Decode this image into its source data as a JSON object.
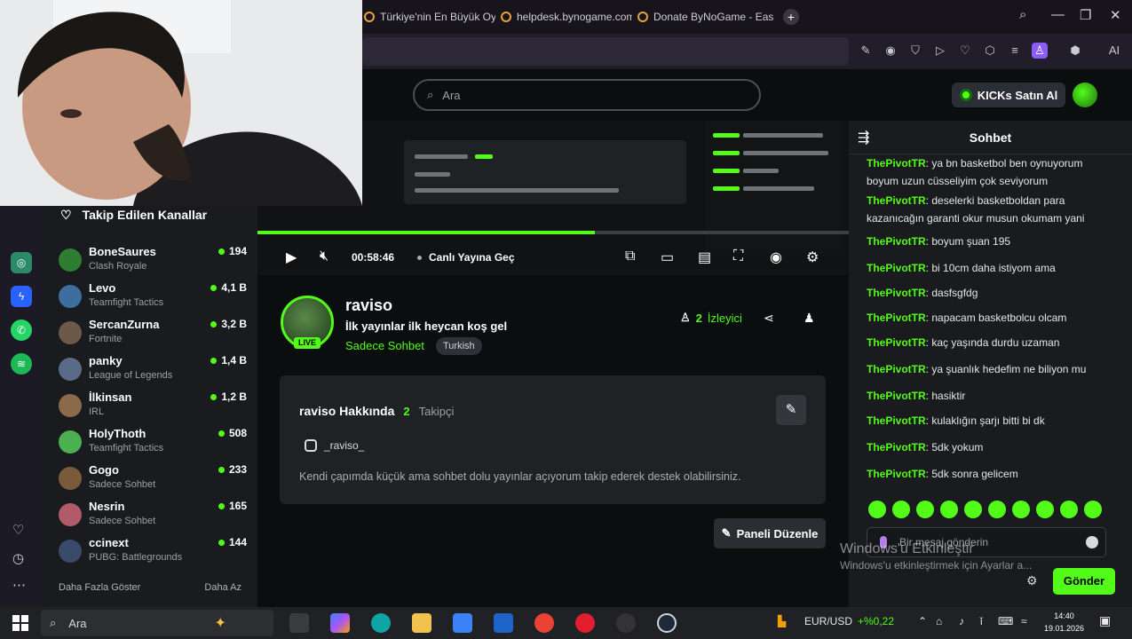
{
  "browser": {
    "tabs": [
      {
        "label": "Türkiye'nin En Büyük Oyu",
        "close": "×"
      },
      {
        "label": "helpdesk.bynogame.com/",
        "close": "×"
      },
      {
        "label": "Donate ByNoGame - Eas",
        "close": "×"
      }
    ],
    "new_tab": "+",
    "ai_label": "AI",
    "accent": "#8b5cf6"
  },
  "header": {
    "search_placeholder": "Ara",
    "buy_kicks": "KICKs Satın Al"
  },
  "sidebar": {
    "title": "Takip Edilen Kanallar",
    "channels": [
      {
        "name": "BoneSaures",
        "category": "Clash Royale",
        "viewers": "194",
        "color": "#2e7d32"
      },
      {
        "name": "Levo",
        "category": "Teamfight Tactics",
        "viewers": "4,1 B",
        "color": "#3c6e9e"
      },
      {
        "name": "SercanZurna",
        "category": "Fortnite",
        "viewers": "3,2 B",
        "color": "#6b5a4a"
      },
      {
        "name": "panky",
        "category": "League of Legends",
        "viewers": "1,4 B",
        "color": "#5a6b8a"
      },
      {
        "name": "İlkinsan",
        "category": "IRL",
        "viewers": "1,2 B",
        "color": "#8a6a4a"
      },
      {
        "name": "HolyThoth",
        "category": "Teamfight Tactics",
        "viewers": "508",
        "color": "#4caf50"
      },
      {
        "name": "Gogo",
        "category": "Sadece Sohbet",
        "viewers": "233",
        "color": "#7a5a3a"
      },
      {
        "name": "Nesrin",
        "category": "Sadece Sohbet",
        "viewers": "165",
        "color": "#b05a6a"
      },
      {
        "name": "ccinext",
        "category": "PUBG: Battlegrounds",
        "viewers": "144",
        "color": "#3a4a6a"
      }
    ],
    "show_more": "Daha Fazla Göster",
    "show_less": "Daha Az"
  },
  "player": {
    "time": "00:58:46",
    "go_live": "Canlı Yayına Geç",
    "progress": 0.57
  },
  "channel": {
    "name": "raviso",
    "stream_title": "İlk yayınlar ilk heycan koş gel",
    "category": "Sadece Sohbet",
    "tag": "Turkish",
    "live_badge": "LIVE",
    "viewer_count": "2",
    "viewer_label": "İzleyici"
  },
  "about": {
    "title": "raviso Hakkında",
    "follower_count": "2",
    "follower_label": "Takipçi",
    "instagram": "_raviso_",
    "description": "Kendi çapımda küçük ama sohbet dolu yayınlar açıyorum takip ederek destek olabilirsiniz.",
    "edit_panel": "Paneli Düzenle"
  },
  "chat": {
    "title": "Sohbet",
    "messages": [
      {
        "user": "ThePivotTR",
        "text": "ya bn basketbol ben oynuyorum boyum uzun cüsseliyim çok seviyorum"
      },
      {
        "user": "ThePivotTR",
        "text": "deselerki basketboldan para kazanıcağın garanti okur musun okumam yani"
      },
      {
        "user": "ThePivotTR",
        "text": "boyum şuan 195"
      },
      {
        "user": "ThePivotTR",
        "text": "bi 10cm daha istiyom ama"
      },
      {
        "user": "ThePivotTR",
        "text": "dasfsgfdg"
      },
      {
        "user": "ThePivotTR",
        "text": "napacam basketbolcu olcam"
      },
      {
        "user": "ThePivotTR",
        "text": "kaç yaşında durdu uzaman"
      },
      {
        "user": "ThePivotTR",
        "text": "ya şuanlık hedefim ne biliyon mu"
      },
      {
        "user": "ThePivotTR",
        "text": "hasiktir"
      },
      {
        "user": "ThePivotTR",
        "text": "kulaklığın şarjı bitti bi dk"
      },
      {
        "user": "ThePivotTR",
        "text": "5dk yokum"
      },
      {
        "user": "ThePivotTR",
        "text": "5dk sonra gelicem"
      }
    ],
    "input_placeholder": "Bir mesaj gönderin",
    "send": "Gönder",
    "accent": "#53fc18"
  },
  "watermark": {
    "line1": "Windows'u Etkinleştir",
    "line2": "Windows'u etkinleştirmek için Ayarlar a..."
  },
  "taskbar": {
    "search_placeholder": "Ara",
    "ticker": "EUR/USD",
    "ticker_change": "+%0,22",
    "time": "14:40",
    "date": "19.01.2026"
  }
}
